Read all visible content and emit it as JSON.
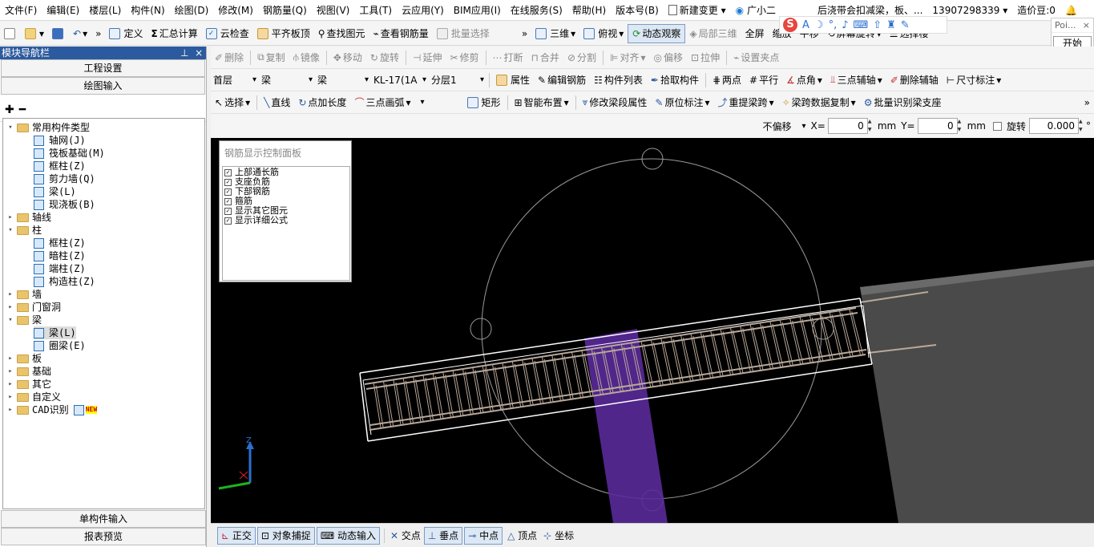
{
  "menubar": {
    "items": [
      "文件(F)",
      "编辑(E)",
      "楼层(L)",
      "构件(N)",
      "绘图(D)",
      "修改(M)",
      "钢筋量(Q)",
      "视图(V)",
      "工具(T)",
      "云应用(Y)",
      "BIM应用(I)",
      "在线服务(S)",
      "帮助(H)",
      "版本号(B)"
    ],
    "new_change": "新建变更",
    "assistant": "广小二",
    "doc_title": "后浇带会扣减梁，板、...",
    "phone": "13907298339",
    "beans": "造价豆:0"
  },
  "toolbar1": {
    "define": "定义",
    "summary_calc": "汇总计算",
    "cloud_check": "云检查",
    "align_slab_top": "平齐板顶",
    "find_element": "查找图元",
    "view_rebar": "查看钢筋量",
    "batch_select": "批量选择",
    "three_d": "三维",
    "top_view": "俯视",
    "dynamic_view": "动态观察",
    "local_3d": "局部三维",
    "full_screen": "全屏",
    "zoom": "缩放",
    "pan": "平移",
    "screen_rotate": "屏幕旋转",
    "select_floor": "选择楼"
  },
  "popup": {
    "title": "Poi...",
    "start": "开始"
  },
  "toolbar2": {
    "delete": "删除",
    "copy": "复制",
    "mirror": "镜像",
    "move": "移动",
    "rotate": "旋转",
    "extend": "延伸",
    "trim": "修剪",
    "break": "打断",
    "merge": "合并",
    "split": "分割",
    "align": "对齐",
    "offset": "偏移",
    "stretch": "拉伸",
    "set_grip": "设置夹点"
  },
  "toolbar3": {
    "floor": "首层",
    "category": "梁",
    "type": "梁",
    "component": "KL-17(1A",
    "layer": "分层1",
    "property": "属性",
    "edit_rebar": "编辑钢筋",
    "component_list": "构件列表",
    "pick": "拾取构件",
    "two_points": "两点",
    "parallel": "平行",
    "point_angle": "点角",
    "three_point_aux": "三点辅轴",
    "delete_aux": "删除辅轴",
    "dimension": "尺寸标注"
  },
  "toolbar4": {
    "select": "选择",
    "line": "直线",
    "point_length": "点加长度",
    "three_point_arc": "三点画弧",
    "rect": "矩形",
    "smart_layout": "智能布置",
    "modify_span": "修改梁段属性",
    "in_situ": "原位标注",
    "re_extract_span": "重提梁跨",
    "span_copy": "梁跨数据复制",
    "batch_identify": "批量识别梁支座"
  },
  "toolbar5": {
    "offset_mode": "不偏移",
    "x_label": "X=",
    "x_value": "0",
    "y_label": "Y=",
    "y_value": "0",
    "unit": "mm",
    "rotate_label": "旋转",
    "rotate_value": "0.000",
    "degree": "°"
  },
  "left_pane": {
    "title": "模块导航栏",
    "project_settings": "工程设置",
    "drawing_input": "绘图输入",
    "single_input": "单构件输入",
    "report_preview": "报表预览",
    "tree": [
      {
        "label": "常用构件类型",
        "level": 0,
        "kind": "folder",
        "exp": "▾"
      },
      {
        "label": "轴网(J)",
        "level": 1,
        "kind": "comp"
      },
      {
        "label": "筏板基础(M)",
        "level": 1,
        "kind": "comp"
      },
      {
        "label": "框柱(Z)",
        "level": 1,
        "kind": "comp"
      },
      {
        "label": "剪力墙(Q)",
        "level": 1,
        "kind": "comp"
      },
      {
        "label": "梁(L)",
        "level": 1,
        "kind": "comp"
      },
      {
        "label": "现浇板(B)",
        "level": 1,
        "kind": "comp"
      },
      {
        "label": "轴线",
        "level": 0,
        "kind": "folder",
        "exp": "▸"
      },
      {
        "label": "柱",
        "level": 0,
        "kind": "folder",
        "exp": "▾"
      },
      {
        "label": "框柱(Z)",
        "level": 1,
        "kind": "comp"
      },
      {
        "label": "暗柱(Z)",
        "level": 1,
        "kind": "comp"
      },
      {
        "label": "端柱(Z)",
        "level": 1,
        "kind": "comp"
      },
      {
        "label": "构造柱(Z)",
        "level": 1,
        "kind": "comp"
      },
      {
        "label": "墙",
        "level": 0,
        "kind": "folder",
        "exp": "▸"
      },
      {
        "label": "门窗洞",
        "level": 0,
        "kind": "folder",
        "exp": "▸"
      },
      {
        "label": "梁",
        "level": 0,
        "kind": "folder",
        "exp": "▾"
      },
      {
        "label": "梁(L)",
        "level": 1,
        "kind": "comp",
        "selected": true
      },
      {
        "label": "圈梁(E)",
        "level": 1,
        "kind": "comp"
      },
      {
        "label": "板",
        "level": 0,
        "kind": "folder",
        "exp": "▸"
      },
      {
        "label": "基础",
        "level": 0,
        "kind": "folder",
        "exp": "▸"
      },
      {
        "label": "其它",
        "level": 0,
        "kind": "folder",
        "exp": "▸"
      },
      {
        "label": "自定义",
        "level": 0,
        "kind": "folder",
        "exp": "▸"
      },
      {
        "label": "CAD识别",
        "level": 0,
        "kind": "folder",
        "exp": "▸",
        "badge": "NEW"
      }
    ]
  },
  "rebar_panel": {
    "title": "钢筋显示控制面板",
    "items": [
      "上部通长筋",
      "支座负筋",
      "下部钢筋",
      "箍筋",
      "显示其它图元",
      "显示详细公式"
    ]
  },
  "axis": {
    "z": "Z"
  },
  "statusbar": {
    "ortho": "正交",
    "snap": "对象捕捉",
    "dynamic_input": "动态输入",
    "intersection": "交点",
    "perpendicular": "垂点",
    "midpoint": "中点",
    "vertex": "顶点",
    "coordinate": "坐标"
  },
  "colors": {
    "nav_title_bg": "#2c5a9e",
    "viewport_bg": "#000000",
    "support": "#5a2a9a",
    "beam_outline": "#ffffff",
    "stirrup": "#b8a89a"
  }
}
